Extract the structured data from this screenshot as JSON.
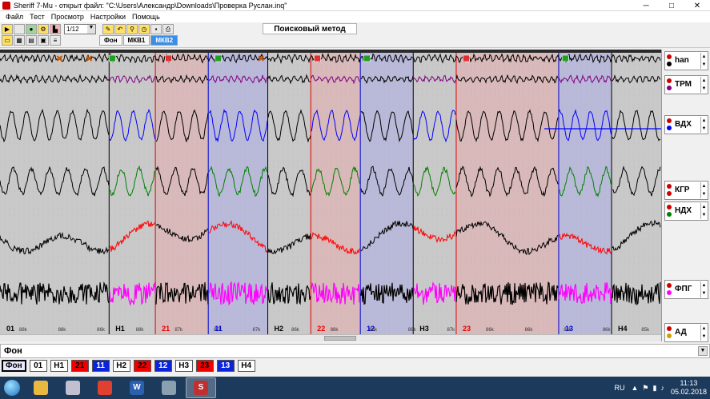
{
  "window": {
    "title": "Sheriff 7-Mu - открыт файл: \"C:\\Users\\Александр\\Downloads\\Проверка Руслан.inq\"",
    "min": "─",
    "max": "□",
    "close": "✕"
  },
  "menu": [
    "Файл",
    "Тест",
    "Просмотр",
    "Настройки",
    "Помощь"
  ],
  "toolbar": {
    "speed_value": "1/12",
    "method_label": "Поисковый метод",
    "tabs": [
      "Фон",
      "МКВ1",
      "МКВ2"
    ],
    "active_tab": "МКВ2"
  },
  "channels": [
    {
      "name": "han",
      "dot_top": "#d00000",
      "dot_bottom": "#000000",
      "color": "#000000"
    },
    {
      "name": "ТРМ",
      "dot_top": "#d00000",
      "dot_bottom": "#800080",
      "color": "#800080"
    },
    {
      "name": "ВДХ",
      "dot_top": "#d00000",
      "dot_bottom": "#0000ff",
      "color": "#0000ff"
    },
    {
      "name": "КГР",
      "dot_top": "#d00000",
      "dot_bottom": "#d00000",
      "color": "#008000"
    },
    {
      "name": "НДХ",
      "dot_top": "#d00000",
      "dot_bottom": "#008000",
      "color": "#ff0000"
    },
    {
      "name": "ФПГ",
      "dot_top": "#d00000",
      "dot_bottom": "#ff00ff",
      "color": "#ff00ff"
    },
    {
      "name": "АД",
      "dot_top": "#d00000",
      "dot_bottom": "#d0a000",
      "color": "#000000"
    }
  ],
  "chart": {
    "segments": [
      {
        "label": "01",
        "color": "#000000",
        "bg": "#c9c9c9",
        "start": 0.0,
        "end": 0.165
      },
      {
        "label": "Н1",
        "color": "#000000",
        "bg": "#c9c9c9",
        "start": 0.165,
        "end": 0.235
      },
      {
        "label": "21",
        "color": "#e00000",
        "bg": "#d9b9b9",
        "start": 0.235,
        "end": 0.315
      },
      {
        "label": "11",
        "color": "#0000d0",
        "bg": "#b9b9d9",
        "start": 0.315,
        "end": 0.405
      },
      {
        "label": "Н2",
        "color": "#000000",
        "bg": "#c9c9c9",
        "start": 0.405,
        "end": 0.47
      },
      {
        "label": "22",
        "color": "#e00000",
        "bg": "#d9b9b9",
        "start": 0.47,
        "end": 0.545
      },
      {
        "label": "12",
        "color": "#0000d0",
        "bg": "#b9b9d9",
        "start": 0.545,
        "end": 0.625
      },
      {
        "label": "Н3",
        "color": "#000000",
        "bg": "#c9c9c9",
        "start": 0.625,
        "end": 0.69
      },
      {
        "label": "23",
        "color": "#e00000",
        "bg": "#d9b9b9",
        "start": 0.69,
        "end": 0.845
      },
      {
        "label": "13",
        "color": "#0000d0",
        "bg": "#b9b9d9",
        "start": 0.845,
        "end": 0.925
      },
      {
        "label": "Н4",
        "color": "#000000",
        "bg": "#c9c9c9",
        "start": 0.925,
        "end": 1.0
      }
    ],
    "hr_labels": [
      "88k",
      "88k",
      "86k",
      "88k",
      "87k",
      "87k",
      "87k",
      "86k",
      "88k",
      "86k",
      "88k",
      "87k",
      "86k",
      "86k",
      "86k",
      "86k",
      "85k"
    ],
    "markers": [
      {
        "pos": 0.09,
        "type": "x",
        "color": "#cc5500"
      },
      {
        "pos": 0.135,
        "type": "x",
        "color": "#cc5500"
      },
      {
        "pos": 0.17,
        "type": "sq",
        "color": "#20a020"
      },
      {
        "pos": 0.255,
        "type": "sq",
        "color": "#e03030"
      },
      {
        "pos": 0.33,
        "type": "sq",
        "color": "#20a020"
      },
      {
        "pos": 0.395,
        "type": "x",
        "color": "#cc5500"
      },
      {
        "pos": 0.48,
        "type": "sq",
        "color": "#e03030"
      },
      {
        "pos": 0.555,
        "type": "sq",
        "color": "#20a020"
      },
      {
        "pos": 0.705,
        "type": "sq",
        "color": "#e03030"
      },
      {
        "pos": 0.855,
        "type": "sq",
        "color": "#20a020"
      }
    ]
  },
  "fon_row": {
    "label": "Фон",
    "dd": "▼"
  },
  "quick_buttons": [
    {
      "label": "Фон",
      "style": "sel"
    },
    {
      "label": "01",
      "style": "plain"
    },
    {
      "label": "Н1",
      "style": "plain"
    },
    {
      "label": "21",
      "style": "red"
    },
    {
      "label": "11",
      "style": "blue"
    },
    {
      "label": "Н2",
      "style": "plain"
    },
    {
      "label": "22",
      "style": "red"
    },
    {
      "label": "12",
      "style": "blue"
    },
    {
      "label": "Н3",
      "style": "plain"
    },
    {
      "label": "23",
      "style": "red"
    },
    {
      "label": "13",
      "style": "blue"
    },
    {
      "label": "Н4",
      "style": "plain"
    }
  ],
  "taskbar": {
    "apps": [
      {
        "name": "explorer",
        "color": "#e8b840",
        "glyph": ""
      },
      {
        "name": "media",
        "color": "#c0c0d0",
        "glyph": ""
      },
      {
        "name": "chrome",
        "color": "#e04030",
        "glyph": ""
      },
      {
        "name": "word",
        "color": "#2b5fb0",
        "glyph": "W"
      },
      {
        "name": "webcam",
        "color": "#8aa0b0",
        "glyph": ""
      },
      {
        "name": "sheriff",
        "color": "#c03030",
        "glyph": "S"
      }
    ],
    "lang": "RU",
    "time": "11:13",
    "date": "05.02.2018"
  }
}
